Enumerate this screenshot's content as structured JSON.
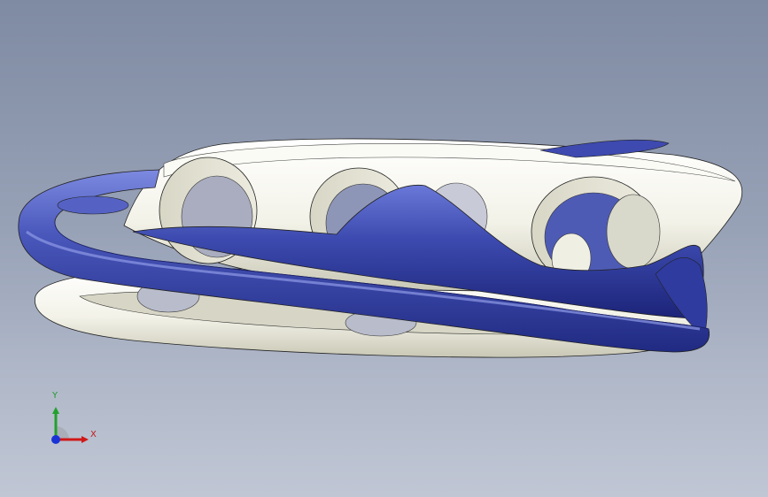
{
  "viewport": {
    "background_top": "#7f8ba3",
    "background_bottom": "#c0c6d4"
  },
  "model": {
    "light_part_color": "#f2f1e6",
    "dark_part_color": "#3a47a8",
    "edge_color": "#222222"
  },
  "triad": {
    "x_label": "X",
    "y_label": "Y",
    "x_color": "#d01818",
    "y_color": "#22a12c",
    "z_color": "#1a33d6"
  }
}
